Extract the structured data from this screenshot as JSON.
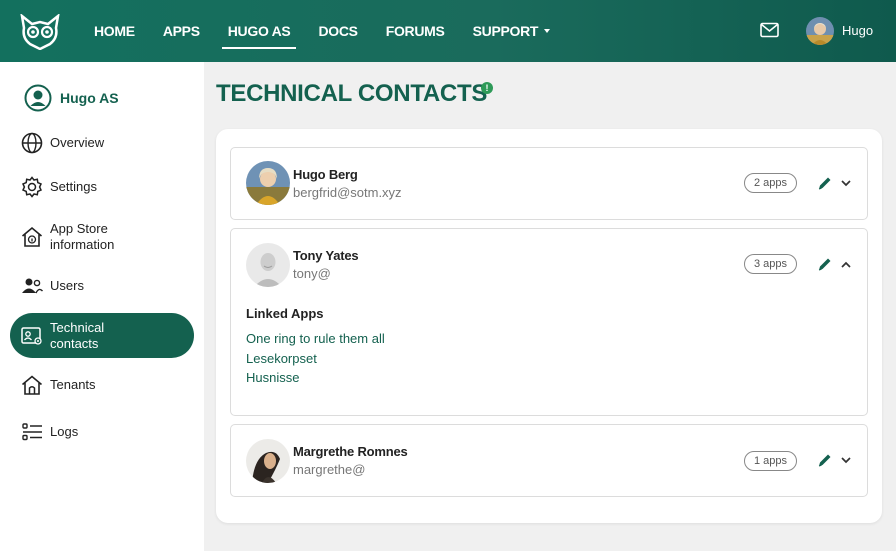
{
  "nav": {
    "items": [
      {
        "label": "HOME"
      },
      {
        "label": "APPS"
      },
      {
        "label": "HUGO AS"
      },
      {
        "label": "DOCS"
      },
      {
        "label": "FORUMS"
      },
      {
        "label": "SUPPORT"
      }
    ],
    "active_index": 2,
    "user_name": "Hugo"
  },
  "sidebar": {
    "org_name": "Hugo AS",
    "items": [
      {
        "label": "Overview",
        "icon": "globe-icon"
      },
      {
        "label": "Settings",
        "icon": "gear-icon"
      },
      {
        "label": "App Store information",
        "icon": "home-info-icon"
      },
      {
        "label": "Users",
        "icon": "users-icon"
      },
      {
        "label": "Technical contacts",
        "icon": "contact-card-gear-icon"
      },
      {
        "label": "Tenants",
        "icon": "house-icon"
      },
      {
        "label": "Logs",
        "icon": "list-icon"
      }
    ],
    "active_index": 4
  },
  "page": {
    "title": "TECHNICAL CONTACTS",
    "info_glyph": "!"
  },
  "contacts": [
    {
      "name": "Hugo Berg",
      "email": "bergfrid@sotm.xyz",
      "apps": "2 apps",
      "expanded": false
    },
    {
      "name": "Tony Yates",
      "email": "tony@",
      "apps": "3 apps",
      "expanded": true,
      "linked_title": "Linked Apps",
      "linked_apps": [
        "One ring to rule them all",
        "Lesekorpset",
        "Husnisse"
      ]
    },
    {
      "name": "Margrethe Romnes",
      "email": "margrethe@",
      "apps": "1 apps",
      "expanded": false
    }
  ],
  "colors": {
    "brand": "#14614f",
    "topbar": "#13705e",
    "info": "#2e9a58"
  }
}
